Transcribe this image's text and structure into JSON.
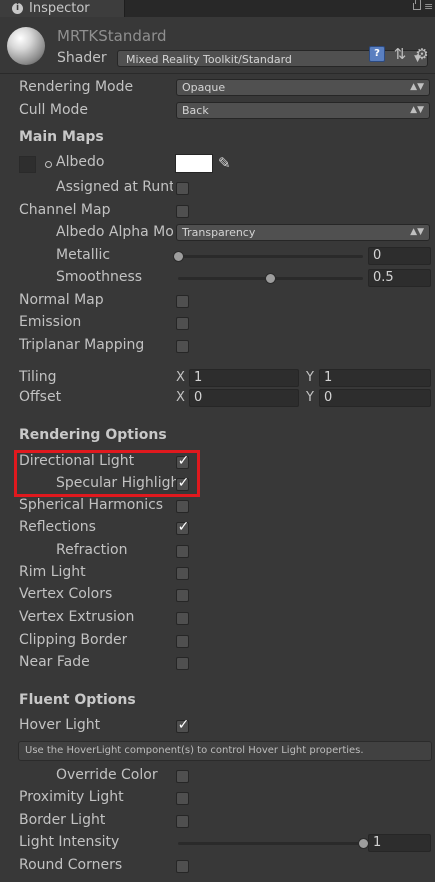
{
  "tab": {
    "title": "Inspector"
  },
  "header": {
    "material_name": "MRTKStandard",
    "shader_label": "Shader",
    "shader_value": "Mixed Reality Toolkit/Standard"
  },
  "rows": {
    "rendering_mode": {
      "label": "Rendering Mode",
      "value": "Opaque"
    },
    "cull_mode": {
      "label": "Cull Mode",
      "value": "Back"
    },
    "main_maps": "Main Maps",
    "albedo": "Albedo",
    "assigned_at_runtime": "Assigned at Runt",
    "channel_map": "Channel Map",
    "albedo_alpha_mode": {
      "label": "Albedo Alpha Mo",
      "value": "Transparency"
    },
    "metallic": {
      "label": "Metallic",
      "value": "0"
    },
    "smoothness": {
      "label": "Smoothness",
      "value": "0.5"
    },
    "normal_map": "Normal Map",
    "emission": "Emission",
    "triplanar_mapping": "Triplanar Mapping",
    "tiling": {
      "label": "Tiling",
      "x_label": "X",
      "x": "1",
      "y_label": "Y",
      "y": "1"
    },
    "offset": {
      "label": "Offset",
      "x_label": "X",
      "x": "0",
      "y_label": "Y",
      "y": "0"
    },
    "rendering_options": "Rendering Options",
    "directional_light": "Directional Light",
    "specular_highlights": "Specular Highligh",
    "spherical_harmonics": "Spherical Harmonics",
    "reflections": "Reflections",
    "refraction": "Refraction",
    "rim_light": "Rim Light",
    "vertex_colors": "Vertex Colors",
    "vertex_extrusion": "Vertex Extrusion",
    "clipping_border": "Clipping Border",
    "near_fade": "Near Fade",
    "fluent_options": "Fluent Options",
    "hover_light": "Hover Light",
    "hover_help": "Use the HoverLight component(s) to control Hover Light properties.",
    "override_color": "Override Color",
    "proximity_light": "Proximity Light",
    "border_light": "Border Light",
    "light_intensity": {
      "label": "Light Intensity",
      "value": "1"
    },
    "round_corners": "Round Corners"
  },
  "checks": {
    "mark": "✓",
    "directional_light": true,
    "specular_highlights": true,
    "reflections": true,
    "hover_light": true
  },
  "sliders": {
    "metallic": 0,
    "smoothness": 0.5,
    "light_intensity": 1
  },
  "colors": {
    "albedo": "#ffffff",
    "highlight_box": "#e0191e"
  },
  "icons": [
    "info-icon",
    "lock-icon",
    "menu-icon",
    "material-sphere-icon",
    "help-book-icon",
    "settings-sliders-icon",
    "gear-icon",
    "eyedropper-icon",
    "object-picker-icon"
  ]
}
